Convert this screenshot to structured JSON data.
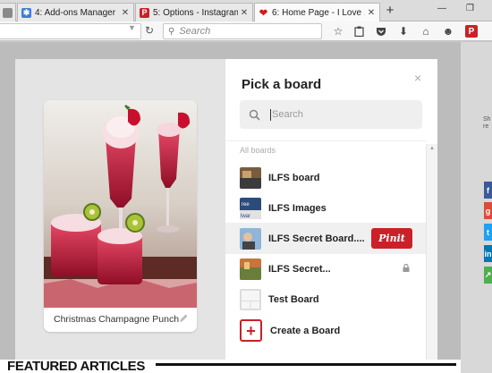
{
  "tabs": [
    {
      "label": "",
      "favicon": "tab-icon"
    },
    {
      "label": "4: Add-ons Manager",
      "favicon": "puzzle-icon"
    },
    {
      "label": "5: Options - Instagram...",
      "favicon": "pinterest-icon"
    },
    {
      "label": "6: Home Page - I Love ...",
      "favicon": "heart-icon"
    }
  ],
  "toolbar": {
    "search_placeholder": "Search",
    "pinterest_badge": "P"
  },
  "modal": {
    "title": "Pick a board",
    "close": "×",
    "search_placeholder": "Search",
    "section_label": "All boards",
    "boards": [
      {
        "name": "ILFS board",
        "secret": false
      },
      {
        "name": "ILFS Images",
        "secret": false
      },
      {
        "name": "ILFS Secret Board....",
        "secret": false,
        "hovered": true
      },
      {
        "name": "ILFS Secret...",
        "secret": true
      },
      {
        "name": "Test Board",
        "secret": false
      }
    ],
    "pin_it_label": "Pinit",
    "create_label": "Create a Board",
    "pin_description": "Christmas Champagne Punch",
    "board_thumb_text": "ree\nlwar"
  },
  "page": {
    "featured": "FEATURED ARTICLES",
    "share_label": "Sh\nre"
  },
  "colors": {
    "pinterest_red": "#cb2027",
    "hover_bg": "#f0f0f0"
  }
}
